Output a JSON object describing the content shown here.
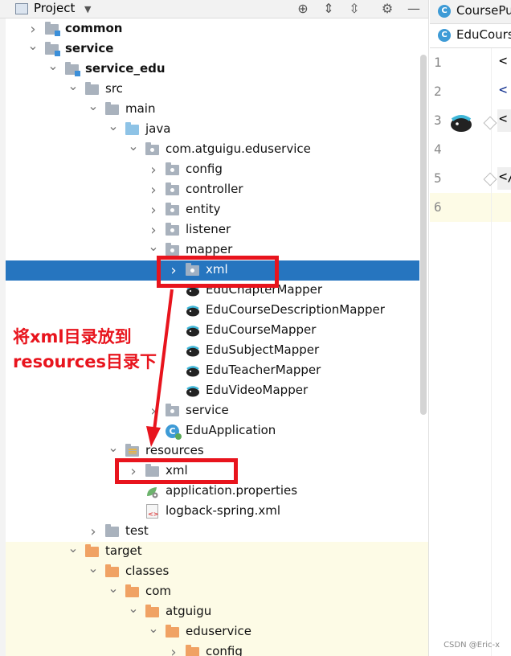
{
  "header": {
    "title": "Project",
    "toolbar_icons": [
      "target-icon",
      "expand-all-icon",
      "collapse-all-icon",
      "settings-icon",
      "minimize-icon"
    ]
  },
  "tree": [
    {
      "label": "common",
      "indent": 1,
      "arrow": "right",
      "icon": "module-folder",
      "bold": true
    },
    {
      "label": "service",
      "indent": 1,
      "arrow": "down",
      "icon": "module-folder",
      "bold": true
    },
    {
      "label": "service_edu",
      "indent": 2,
      "arrow": "down",
      "icon": "module-folder",
      "bold": true
    },
    {
      "label": "src",
      "indent": 3,
      "arrow": "down",
      "icon": "folder"
    },
    {
      "label": "main",
      "indent": 4,
      "arrow": "down",
      "icon": "folder"
    },
    {
      "label": "java",
      "indent": 5,
      "arrow": "down",
      "icon": "folder-blue"
    },
    {
      "label": "com.atguigu.eduservice",
      "indent": 6,
      "arrow": "down",
      "icon": "package"
    },
    {
      "label": "config",
      "indent": 7,
      "arrow": "right",
      "icon": "package"
    },
    {
      "label": "controller",
      "indent": 7,
      "arrow": "right",
      "icon": "package"
    },
    {
      "label": "entity",
      "indent": 7,
      "arrow": "right",
      "icon": "package"
    },
    {
      "label": "listener",
      "indent": 7,
      "arrow": "right",
      "icon": "package"
    },
    {
      "label": "mapper",
      "indent": 7,
      "arrow": "down",
      "icon": "package"
    },
    {
      "label": "xml",
      "indent": 8,
      "arrow": "right",
      "icon": "package",
      "selected": true
    },
    {
      "label": "EduChapterMapper",
      "indent": 8,
      "arrow": "",
      "icon": "mybatis"
    },
    {
      "label": "EduCourseDescriptionMapper",
      "indent": 8,
      "arrow": "",
      "icon": "mybatis"
    },
    {
      "label": "EduCourseMapper",
      "indent": 8,
      "arrow": "",
      "icon": "mybatis"
    },
    {
      "label": "EduSubjectMapper",
      "indent": 8,
      "arrow": "",
      "icon": "mybatis"
    },
    {
      "label": "EduTeacherMapper",
      "indent": 8,
      "arrow": "",
      "icon": "mybatis"
    },
    {
      "label": "EduVideoMapper",
      "indent": 8,
      "arrow": "",
      "icon": "mybatis"
    },
    {
      "label": "service",
      "indent": 7,
      "arrow": "right",
      "icon": "package"
    },
    {
      "label": "EduApplication",
      "indent": 7,
      "arrow": "",
      "icon": "spring-class"
    },
    {
      "label": "resources",
      "indent": 5,
      "arrow": "down",
      "icon": "resources-folder"
    },
    {
      "label": "xml",
      "indent": 6,
      "arrow": "right",
      "icon": "folder"
    },
    {
      "label": "application.properties",
      "indent": 6,
      "arrow": "",
      "icon": "properties"
    },
    {
      "label": "logback-spring.xml",
      "indent": 6,
      "arrow": "",
      "icon": "xml-file"
    },
    {
      "label": "test",
      "indent": 4,
      "arrow": "right",
      "icon": "folder"
    },
    {
      "label": "target",
      "indent": 3,
      "arrow": "down",
      "icon": "folder-orange",
      "excluded": true
    },
    {
      "label": "classes",
      "indent": 4,
      "arrow": "down",
      "icon": "folder-orange",
      "excluded": true
    },
    {
      "label": "com",
      "indent": 5,
      "arrow": "down",
      "icon": "folder-orange",
      "excluded": true
    },
    {
      "label": "atguigu",
      "indent": 6,
      "arrow": "down",
      "icon": "folder-orange",
      "excluded": true
    },
    {
      "label": "eduservice",
      "indent": 7,
      "arrow": "down",
      "icon": "folder-orange",
      "excluded": true
    },
    {
      "label": "config",
      "indent": 8,
      "arrow": "right",
      "icon": "folder-orange",
      "excluded": true
    }
  ],
  "editor": {
    "tabs": [
      "CoursePu",
      "EduCours"
    ],
    "lines": [
      {
        "num": "1",
        "code": "<"
      },
      {
        "num": "2",
        "code": "<"
      },
      {
        "num": "3",
        "code": "<"
      },
      {
        "num": "4",
        "code": ""
      },
      {
        "num": "5",
        "code": "</"
      },
      {
        "num": "6",
        "code": ""
      }
    ],
    "watermark": "CSDN @Eric-x"
  },
  "annotation": {
    "line1": "将xml目录放到",
    "line2": "resources目录下",
    "color": "#e8141d"
  },
  "colors": {
    "selection": "#2675bf",
    "excluded_bg": "#fdfbe6",
    "accent_red": "#e8141d"
  }
}
